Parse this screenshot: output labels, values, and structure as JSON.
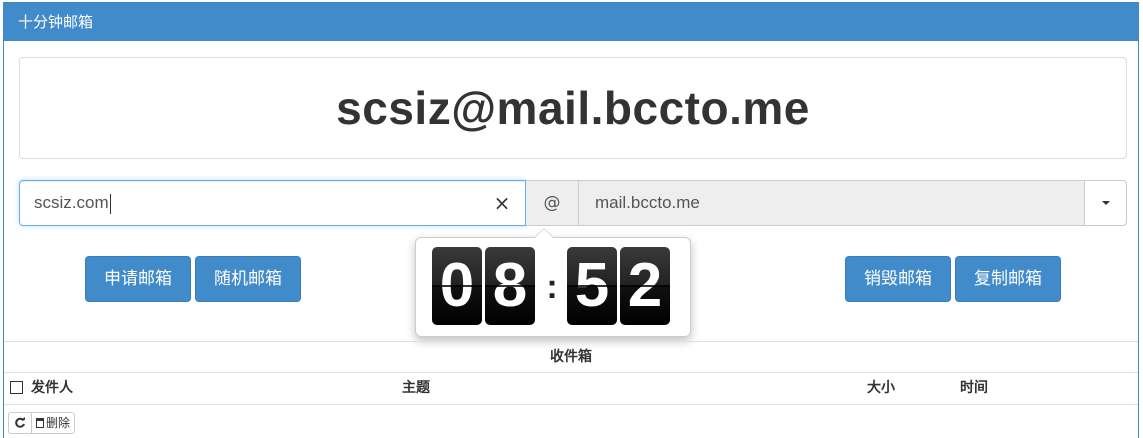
{
  "app": {
    "title": "十分钟邮箱"
  },
  "email": {
    "full_address": "scsiz@mail.bccto.me"
  },
  "form": {
    "name_value": "scsiz.com",
    "clear_icon": "×",
    "at_label": "@",
    "domain_value": "mail.bccto.me"
  },
  "buttons": {
    "apply": "申请邮箱",
    "random": "随机邮箱",
    "destroy": "销毁邮箱",
    "copy": "复制邮箱"
  },
  "timer": {
    "d1": "0",
    "d2": "8",
    "sep": ":",
    "d3": "5",
    "d4": "2"
  },
  "inbox": {
    "title": "收件箱",
    "columns": {
      "sender": "发件人",
      "subject": "主题",
      "size": "大小",
      "time": "时间"
    }
  },
  "toolbar": {
    "delete_label": "删除",
    "refresh_icon": "refresh-icon",
    "trash_icon": "trash-icon"
  },
  "colors": {
    "primary": "#428bca",
    "border": "#dddddd"
  }
}
